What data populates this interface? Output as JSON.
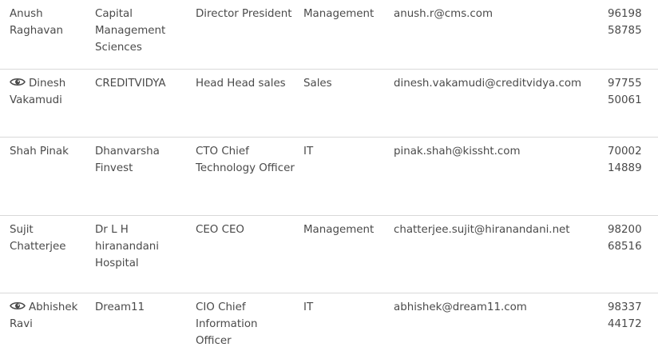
{
  "rows": [
    {
      "has_view_icon": false,
      "name": "Anush Raghavan",
      "name_line1": "Anush",
      "name_line2": "Raghavan",
      "company": "Capital Management Sciences",
      "title": "Director President",
      "department": "Management",
      "email": "anush.r@cms.com",
      "phone_line1": "96198",
      "phone_line2": "58785"
    },
    {
      "has_view_icon": true,
      "name": "Dinesh Vakamudi",
      "name_line1": "Dinesh",
      "name_line2": "Vakamudi",
      "company": "CREDITVIDYA",
      "title": "Head Head sales",
      "department": "Sales",
      "email": "dinesh.vakamudi@creditvidya.com",
      "phone_line1": "97755",
      "phone_line2": "50061"
    },
    {
      "has_view_icon": false,
      "name": "Shah Pinak",
      "name_line1": "Shah Pinak",
      "name_line2": "",
      "company": "Dhanvarsha Finvest",
      "title": "CTO Chief Technology Officer",
      "department": "IT",
      "email": "pinak.shah@kissht.com",
      "phone_line1": "70002",
      "phone_line2": "14889"
    },
    {
      "has_view_icon": false,
      "name": "Sujit Chatterjee",
      "name_line1": "Sujit",
      "name_line2": "Chatterjee",
      "company": "Dr L H hiranandani Hospital",
      "title": "CEO CEO",
      "department": "Management",
      "email": "chatterjee.sujit@hiranandani.net",
      "phone_line1": "98200",
      "phone_line2": "68516"
    },
    {
      "has_view_icon": true,
      "name": "Abhishek Ravi",
      "name_line1": "Abhishek",
      "name_line2": "Ravi",
      "company": "Dream11",
      "title": "CIO Chief Information Officer",
      "department": "IT",
      "email": "abhishek@dream11.com",
      "phone_line1": "98337",
      "phone_line2": "44172"
    }
  ],
  "icons": {
    "view": "eye-icon"
  },
  "colors": {
    "text": "#4a4a4a",
    "divider": "#d9d9d9",
    "background": "#ffffff"
  }
}
